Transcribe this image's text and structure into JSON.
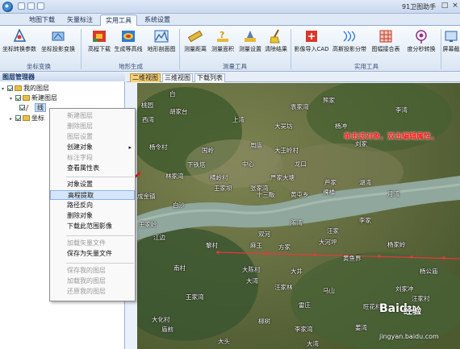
{
  "window": {
    "title": "91卫图助手",
    "minimize": "–",
    "maximize": "□",
    "close": "×"
  },
  "tabs": [
    "地图下载",
    "矢量标注",
    "实用工具",
    "系统设置"
  ],
  "ribbon": {
    "buttons": [
      {
        "label": "坐标转换参数",
        "icon": "axis-icon"
      },
      {
        "label": "坐标投影变换",
        "icon": "projection-icon"
      },
      {
        "label": "高程下载",
        "icon": "dem-icon"
      },
      {
        "label": "生成等高线",
        "icon": "contour-icon"
      },
      {
        "label": "地形剖面图",
        "icon": "profile-icon"
      },
      {
        "label": "测量距离",
        "icon": "ruler-icon"
      },
      {
        "label": "测量面积",
        "icon": "area-icon"
      },
      {
        "label": "测量设置",
        "icon": "measure-settings-icon"
      },
      {
        "label": "清除结果",
        "icon": "broom-icon"
      },
      {
        "label": "影像导入CAD",
        "icon": "cad-icon"
      },
      {
        "label": "高斯投影分带",
        "icon": "gauss-icon"
      },
      {
        "label": "图幅接合表",
        "icon": "grid-icon"
      },
      {
        "label": "度分秒转换",
        "icon": "dms-icon"
      },
      {
        "label": "屏幕截",
        "icon": "screenshot-icon"
      }
    ],
    "groups": [
      "坐标变换",
      "地形生成",
      "测量工具",
      "实用工具"
    ]
  },
  "layer_panel": {
    "title": "图层管理器",
    "tree": [
      {
        "label": "我的图层"
      },
      {
        "label": "新建图层"
      },
      {
        "label": "线"
      },
      {
        "label": "坐标"
      }
    ]
  },
  "context_menu": {
    "items": [
      {
        "label": "新建图层",
        "disabled": true
      },
      {
        "label": "删除图层",
        "disabled": true
      },
      {
        "label": "图层设置",
        "disabled": true
      },
      {
        "label": "创建对象",
        "disabled": false,
        "submenu": true
      },
      {
        "label": "标注字段",
        "disabled": true
      },
      {
        "label": "查看属性表",
        "disabled": false
      },
      {
        "label": "对象设置",
        "disabled": false
      },
      {
        "label": "高程提取",
        "disabled": false,
        "highlighted": true
      },
      {
        "label": "路径反向",
        "disabled": false
      },
      {
        "label": "删除对象",
        "disabled": false
      },
      {
        "label": "下载此范围影像",
        "disabled": false
      },
      {
        "label": "加载矢量文件",
        "disabled": true
      },
      {
        "label": "保存为矢量文件",
        "disabled": false
      },
      {
        "label": "保存我的图层",
        "disabled": true
      },
      {
        "label": "加载我的图层",
        "disabled": true
      },
      {
        "label": "还原我的图层",
        "disabled": true
      }
    ],
    "submenu_arrow": "▸"
  },
  "map_tabs": [
    "二维视图",
    "三维视图",
    "下载列表"
  ],
  "map": {
    "annotation": "单击该对象，双击编辑属性，",
    "places": [
      "白",
      "桃园",
      "胡家台",
      "西湾",
      "上湾",
      "大吴坊",
      "杨冲",
      "杨令村",
      "国岭",
      "周庙",
      "袁家湾",
      "熊家",
      "李湾",
      "刘家",
      "龙口",
      "中心",
      "横岭村",
      "王家坝",
      "芦家",
      "大王岭村",
      "下铁塔",
      "林家湾",
      "严家大塘",
      "张家湾",
      "十三畈",
      "黄屯乡",
      "牌楼",
      "湖湾",
      "成金镇",
      "月湾",
      "白沙",
      "王家岭",
      "江边",
      "陈湾",
      "双河",
      "汪家",
      "李家",
      "黎村",
      "麻王",
      "方家",
      "大河坪",
      "黄鱼界",
      "杨家岭",
      "南村",
      "大陈村",
      "大井",
      "大湾",
      "杨公庙",
      "汪家林",
      "马山",
      "大化村",
      "庙前",
      "雷庄",
      "旺花村",
      "柳树",
      "大头",
      "大湾",
      "姜湾",
      "汪家村",
      "李家湾",
      "王家湾",
      "刘家冲"
    ],
    "watermark_logo": "Baidu",
    "watermark_text": "经验",
    "watermark_url": "jingyan.baidu.com"
  }
}
